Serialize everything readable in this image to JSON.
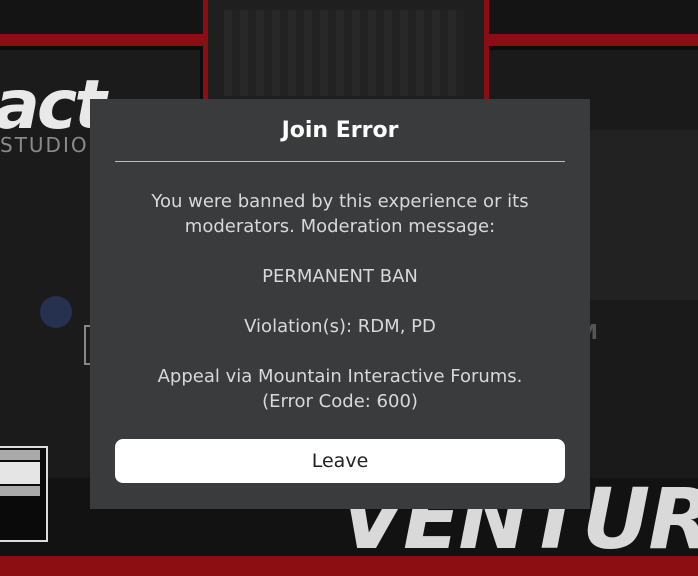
{
  "background": {
    "logo_text": "act",
    "logo_sub": "STUDIOS",
    "sign_text": "VENTURA",
    "corner_letter": "M"
  },
  "dialog": {
    "title": "Join Error",
    "message_line1": "You were banned by this experience or its",
    "message_line2": "moderators. Moderation message:",
    "ban_type": "PERMANENT BAN",
    "violations": "Violation(s): RDM, PD",
    "appeal": "Appeal via Mountain Interactive Forums.",
    "error_code": "(Error Code: 600)",
    "leave_label": "Leave"
  },
  "colors": {
    "dialog_bg": "#393b3d",
    "accent_red": "#8c0d12",
    "button_bg": "#ffffff"
  }
}
